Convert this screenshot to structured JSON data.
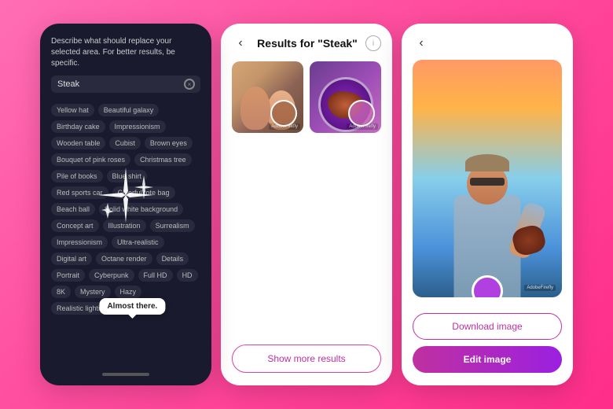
{
  "panel1": {
    "title": "Describe what should replace your selected area. For better results, be specific.",
    "input_value": "Steak",
    "sparkle_label": "sparkles",
    "almost_there": "Almost there.",
    "tags": [
      "Yellow hat",
      "Beautiful galaxy",
      "Birthday cake",
      "Impressionism",
      "Wooden table",
      "Cubist",
      "Brown eyes",
      "Bouquet of pink roses",
      "Christmas tree",
      "Pile of books",
      "Blue shirt",
      "Red sports car",
      "Colorful tote bag",
      "Beach ball",
      "Solid white background",
      "Concept art",
      "Illustration",
      "Surrealism",
      "Impressionism",
      "Ultra-realistic",
      "Digital art",
      "Octane render",
      "Details",
      "Portrait",
      "Cyberpunk",
      "Full HD",
      "HD",
      "8K",
      "Mystery",
      "Hazy",
      "Realistic lighting"
    ]
  },
  "panel2": {
    "back_icon": "‹",
    "info_icon": "i",
    "title": "Results for \"Steak\"",
    "watermark1": "AdobeFirefly",
    "watermark2": "AdobeFirefly",
    "show_more_label": "Show more results"
  },
  "panel3": {
    "back_icon": "‹",
    "watermark": "AdobeFirefly",
    "download_label": "Download image",
    "edit_label": "Edit image"
  }
}
